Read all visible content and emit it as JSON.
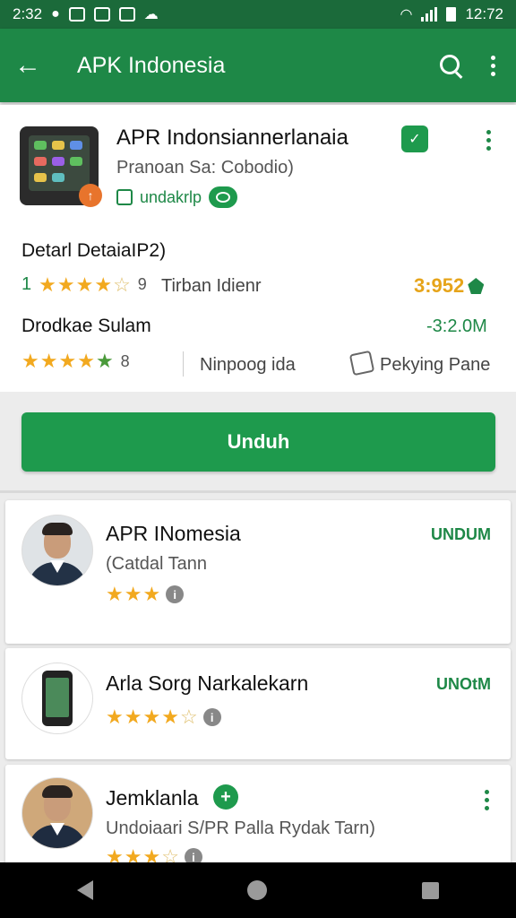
{
  "status_bar": {
    "time_left": "2:32",
    "time_right": "12:72",
    "icons": [
      "notification-icon",
      "message-icon",
      "gallery-icon",
      "app-icon",
      "cloud-icon",
      "wifi-icon",
      "signal-icon",
      "battery-icon"
    ]
  },
  "app_bar": {
    "title": "APK Indonesia",
    "back_icon": "arrow-left-icon",
    "search_icon": "search-icon",
    "more_icon": "more-vert-icon"
  },
  "app_detail": {
    "name": "APR Indonsiannerlanaia",
    "developer": "Pranoan Sa: Cobodio)",
    "chip_label": "undakrlp",
    "section_title": "Detarl DetaiaIP2)",
    "rating_lead": "1",
    "rating_count": "9",
    "rating_note": "Tirban Idienr",
    "score": "3:952",
    "subsection_title": "Drodkae Sulam",
    "size": "-3:2.0M",
    "row2_count": "8",
    "tag": "Ninpoog ida",
    "package_label": "Pekying Pane"
  },
  "download_button": {
    "label": "Unduh"
  },
  "list": [
    {
      "title": "APR INomesia",
      "subtitle": "(Catdal Tann",
      "action": "UNDUM",
      "rating": 3
    },
    {
      "title": "Arla Sorg Narkalekarn",
      "subtitle": "",
      "action": "UNOtM",
      "rating": 3.5
    },
    {
      "title": "Jemklanla",
      "subtitle": "Undoiaari S/PR Palla Rydak Tarn)",
      "action": "",
      "rating": 3.5
    }
  ],
  "colors": {
    "brand": "#1e8847",
    "status_bar": "#1b6a3a",
    "button": "#1e9a4d",
    "star": "#f2a91f",
    "score": "#e6a41a"
  }
}
